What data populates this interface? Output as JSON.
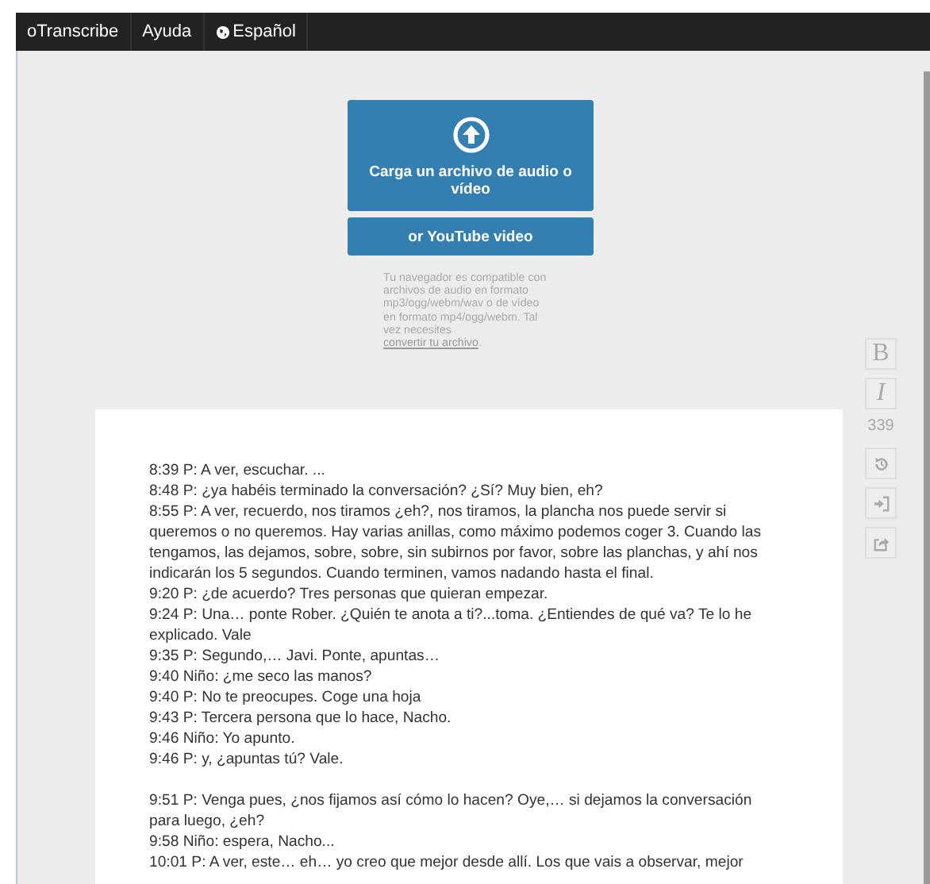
{
  "nav": {
    "brand": "oTranscribe",
    "items": [
      {
        "label": "Ayuda",
        "kind": "link"
      },
      {
        "label": "Español",
        "kind": "language"
      }
    ]
  },
  "upload": {
    "label": "Carga un archivo de audio o vídeo",
    "youtube": "or YouTube video",
    "note": "Tu navegador es compatible con archivos de audio en formato mp3/ogg/webm/wav o de vídeo en formato mp4/ogg/webm. Tal vez necesites ",
    "note_link": "convertir tu archivo",
    "note_end": "."
  },
  "toolbar": [
    {
      "kind": "bold",
      "label": "B"
    },
    {
      "kind": "italic",
      "label": "I"
    },
    {
      "kind": "count",
      "label": "339"
    },
    {
      "kind": "history"
    },
    {
      "kind": "import"
    },
    {
      "kind": "export"
    }
  ],
  "transcript": [
    {
      "lines": [
        "8:39 P: A ver, escuchar. ...",
        "8:48 P: ¿ya habéis terminado la conversación? ¿Sí? Muy bien, eh?",
        "8:55 P: A ver, recuerdo, nos tiramos ¿eh?, nos tiramos, la plancha nos puede servir si queremos o no queremos. Hay varias anillas, como máximo podemos coger 3. Cuando las tengamos, las dejamos, sobre, sobre, sin subirnos por favor, sobre las planchas, y ahí nos indicarán los 5 segundos. Cuando terminen, vamos nadando hasta el final.",
        "9:20 P: ¿de acuerdo? Tres personas que quieran empezar.",
        "9:24 P: Una… ponte Rober. ¿Quién te anota a ti?...toma. ¿Entiendes de qué va? Te lo he explicado. Vale",
        "9:35 P: Segundo,… Javi. Ponte, apuntas…",
        "9:40 Niño: ¿me seco las manos?",
        "9:40 P: No te preocupes. Coge una hoja",
        "9:43 P: Tercera persona que lo hace, Nacho.",
        "9:46 Niño: Yo apunto.",
        "9:46 P: y, ¿apuntas tú? Vale."
      ]
    },
    {
      "lines": [
        "9:51 P: Venga pues, ¿nos fijamos así cómo lo hacen? Oye,… si dejamos la conversación para luego, ¿eh?",
        "9:58 Niño: espera, Nacho...",
        "10:01 P: A ver, este… eh… yo creo que mejor desde allí. Los que vais a observar, mejor"
      ]
    }
  ]
}
